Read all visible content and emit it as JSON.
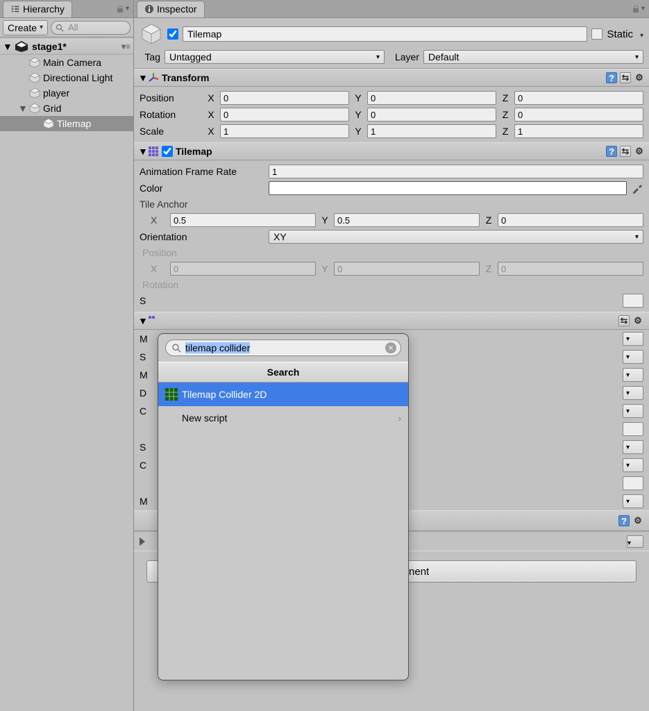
{
  "hierarchy": {
    "tab_label": "Hierarchy",
    "create_label": "Create",
    "search_placeholder": "All",
    "scene_name": "stage1*",
    "items": [
      {
        "label": "Main Camera",
        "indent": 1,
        "fold": "",
        "selected": false
      },
      {
        "label": "Directional Light",
        "indent": 1,
        "fold": "",
        "selected": false
      },
      {
        "label": "player",
        "indent": 1,
        "fold": "",
        "selected": false
      },
      {
        "label": "Grid",
        "indent": 1,
        "fold": "▼",
        "selected": false
      },
      {
        "label": "Tilemap",
        "indent": 2,
        "fold": "",
        "selected": true
      }
    ]
  },
  "inspector": {
    "tab_label": "Inspector",
    "object_name": "Tilemap",
    "static_label": "Static",
    "tag_label": "Tag",
    "tag_value": "Untagged",
    "layer_label": "Layer",
    "layer_value": "Default"
  },
  "transform": {
    "title": "Transform",
    "position_label": "Position",
    "rotation_label": "Rotation",
    "scale_label": "Scale",
    "x": "X",
    "y": "Y",
    "z": "Z",
    "pos": {
      "x": "0",
      "y": "0",
      "z": "0"
    },
    "rot": {
      "x": "0",
      "y": "0",
      "z": "0"
    },
    "scl": {
      "x": "1",
      "y": "1",
      "z": "1"
    }
  },
  "tilemap": {
    "title": "Tilemap",
    "anim_label": "Animation Frame Rate",
    "anim_value": "1",
    "color_label": "Color",
    "tile_anchor_label": "Tile Anchor",
    "x": "X",
    "y": "Y",
    "z": "Z",
    "anchor": {
      "x": "0.5",
      "y": "0.5",
      "z": "0"
    },
    "orientation_label": "Orientation",
    "orientation_value": "XY",
    "position_label": "Position",
    "pos": {
      "x": "0",
      "y": "0",
      "z": "0"
    },
    "rotation_label": "Rotation",
    "s_letter": "S"
  },
  "obscured_rows": [
    "M",
    "S",
    "M",
    "D",
    "C",
    "",
    "S",
    "C",
    "",
    "M"
  ],
  "add_component_label": "Add Component",
  "popup": {
    "search_text": "tilemap collider",
    "heading": "Search",
    "items": [
      {
        "label": "Tilemap Collider 2D",
        "selected": true,
        "chev": false,
        "icon": "grid"
      },
      {
        "label": "New script",
        "selected": false,
        "chev": true,
        "icon": "none"
      }
    ]
  }
}
